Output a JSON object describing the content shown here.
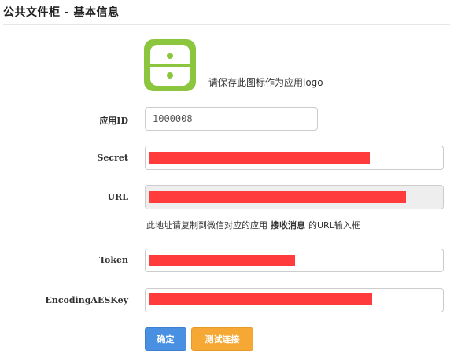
{
  "header": {
    "title": "公共文件柜 - 基本信息"
  },
  "logo": {
    "hint": "请保存此图标作为应用logo",
    "icon": "cabinet-logo-icon",
    "color": "#8cc63f"
  },
  "form": {
    "app_id": {
      "label": "应用ID",
      "value": "1000008"
    },
    "secret": {
      "label": "Secret"
    },
    "url": {
      "label": "URL",
      "help_prefix": "此地址请复制到微信对应的应用",
      "help_emphasis": "接收消息",
      "help_suffix": "的URL输入框"
    },
    "token": {
      "label": "Token"
    },
    "aes_key": {
      "label": "EncodingAESKey"
    }
  },
  "buttons": {
    "confirm": "确定",
    "test": "测试连接"
  },
  "colors": {
    "redaction": "#ff3b3b",
    "primary_button": "#4a90e2",
    "warning_button": "#f5a934"
  }
}
